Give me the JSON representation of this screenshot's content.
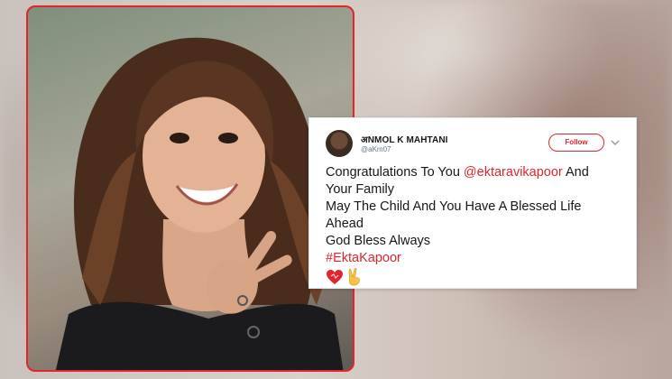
{
  "tweet": {
    "display_name": "अNMOL K MAHTANI",
    "handle": "@aKm07",
    "follow_label": "Follow",
    "lines": {
      "l1_pre": "Congratulations To You ",
      "l1_mention": "@ektaravikapoor",
      "l1_post": " And",
      "l2": "Your Family",
      "l3": "May The Child And You Have A Blessed Life",
      "l4": "Ahead",
      "l5": "God Bless Always",
      "l6_hashtag": "#EktaKapoor"
    },
    "emojis": [
      "heart-icon",
      "victory-hand-icon"
    ]
  },
  "colors": {
    "accent": "#e0262b",
    "text": "#14171a",
    "muted": "#657786"
  }
}
